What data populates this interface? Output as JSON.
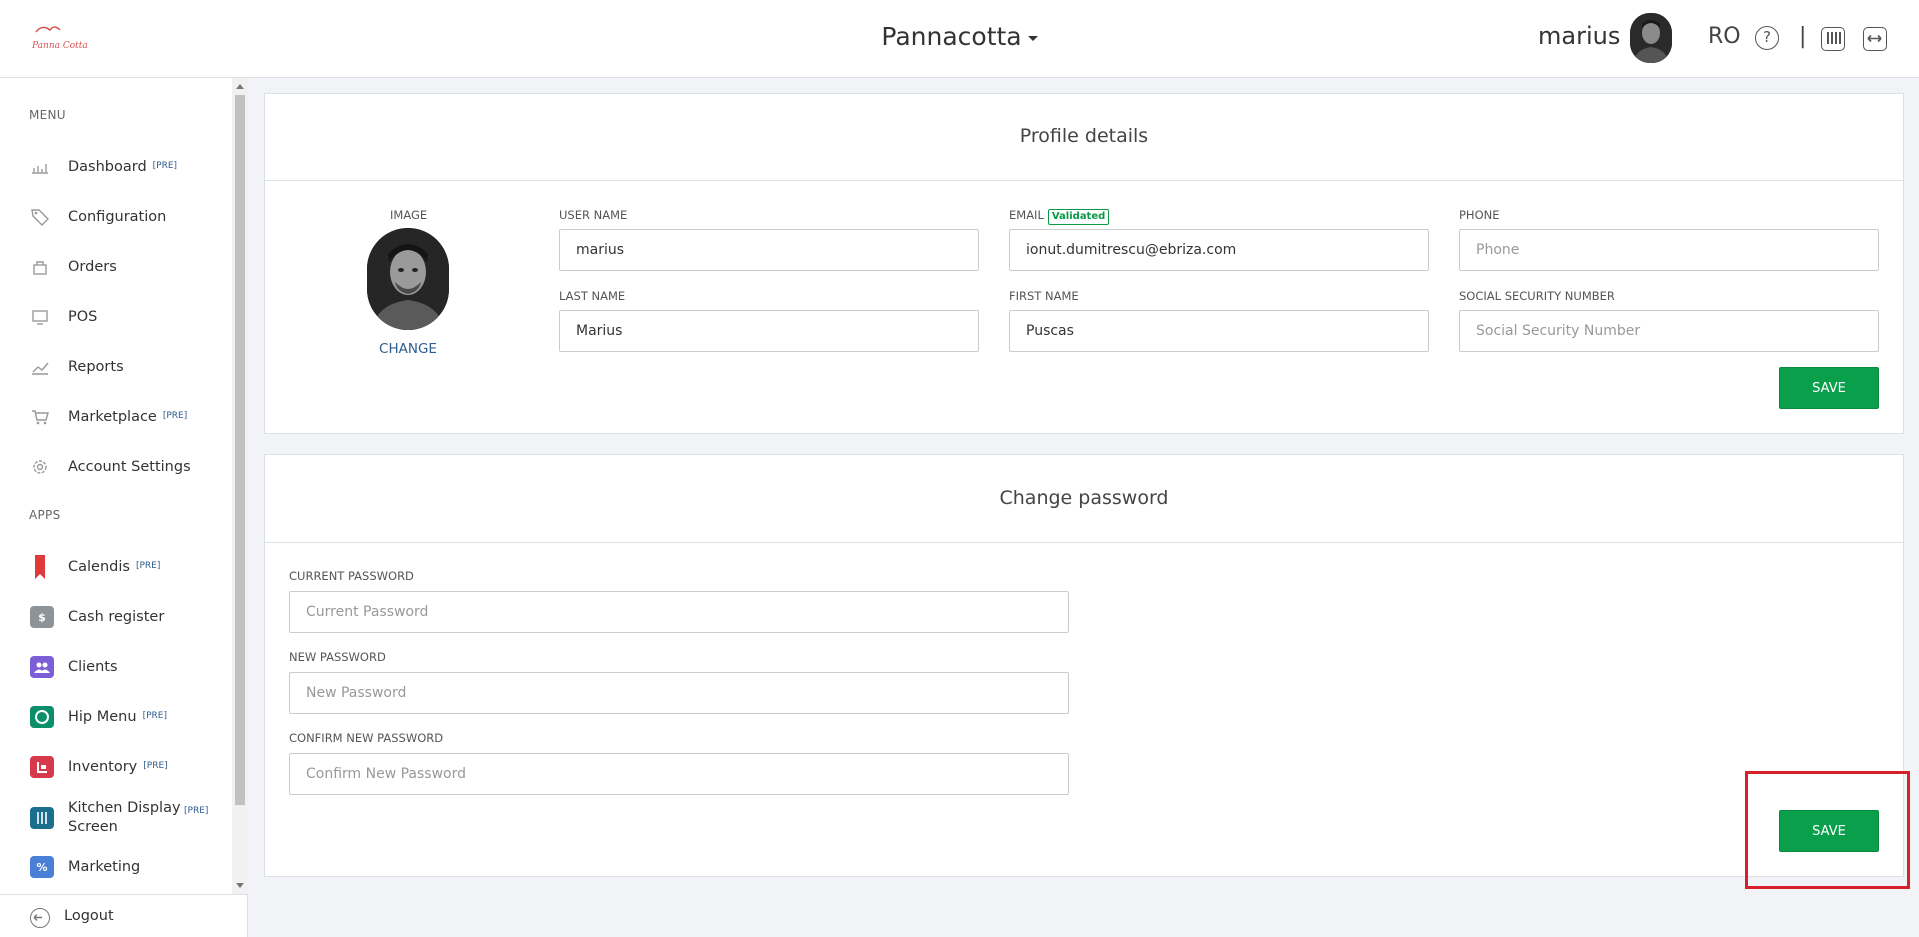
{
  "header": {
    "brand": "Pannacotta",
    "user_name": "marius",
    "language": "RO",
    "help_symbol": "?",
    "separator": "|",
    "icons": [
      "logo",
      "avatar",
      "help-icon",
      "caret-down-icon",
      "terminal-icon",
      "expand-icon"
    ]
  },
  "sidebar": {
    "menu_title": "MENU",
    "menu_items": [
      {
        "label": "Dashboard",
        "badge": "[PRE]",
        "icon": "chart-icon"
      },
      {
        "label": "Configuration",
        "badge": "",
        "icon": "tag-icon"
      },
      {
        "label": "Orders",
        "badge": "",
        "icon": "orders-icon"
      },
      {
        "label": "POS",
        "badge": "",
        "icon": "pos-icon"
      },
      {
        "label": "Reports",
        "badge": "",
        "icon": "reports-icon"
      },
      {
        "label": "Marketplace",
        "badge": "[PRE]",
        "icon": "cart-icon"
      },
      {
        "label": "Account Settings",
        "badge": "",
        "icon": "gear-icon"
      }
    ],
    "apps_title": "APPS",
    "apps": [
      {
        "label": "Calendis",
        "badge": "[PRE]",
        "icon": "bookmark-icon",
        "color": "#e03a3a"
      },
      {
        "label": "Cash register",
        "badge": "",
        "icon": "cash-register-icon",
        "color": "#8c9499"
      },
      {
        "label": "Clients",
        "badge": "",
        "icon": "clients-icon",
        "color": "#7c5fd6"
      },
      {
        "label": "Hip Menu",
        "badge": "[PRE]",
        "icon": "hipmenu-icon",
        "color": "#0a8f6a"
      },
      {
        "label": "Inventory",
        "badge": "[PRE]",
        "icon": "inventory-icon",
        "color": "#d6394a"
      },
      {
        "label": "Kitchen Display",
        "label2": "Screen",
        "badge": "[PRE]",
        "icon": "cutlery-icon",
        "color": "#1a6f8f"
      },
      {
        "label": "Marketing",
        "badge": "",
        "icon": "marketing-icon",
        "color": "#4a7fd6"
      }
    ],
    "logout": "Logout"
  },
  "profile": {
    "title": "Profile details",
    "image_label": "IMAGE",
    "change_label": "CHANGE",
    "username_label": "USER NAME",
    "username_value": "marius",
    "email_label": "EMAIL",
    "email_badge": "Validated",
    "email_value": "ionut.dumitrescu@ebriza.com",
    "phone_label": "PHONE",
    "phone_placeholder": "Phone",
    "lastname_label": "LAST NAME",
    "lastname_value": "Marius",
    "firstname_label": "FIRST NAME",
    "firstname_value": "Puscas",
    "ssn_label": "SOCIAL SECURITY NUMBER",
    "ssn_placeholder": "Social Security Number",
    "save_label": "SAVE"
  },
  "password": {
    "title": "Change password",
    "current_label": "CURRENT PASSWORD",
    "current_placeholder": "Current Password",
    "new_label": "NEW PASSWORD",
    "new_placeholder": "New Password",
    "confirm_label": "CONFIRM NEW PASSWORD",
    "confirm_placeholder": "Confirm New Password",
    "save_label": "SAVE"
  },
  "colors": {
    "accent_green": "#0aa04b",
    "link_blue": "#2f5c8f",
    "highlight_red": "#d6202a"
  }
}
